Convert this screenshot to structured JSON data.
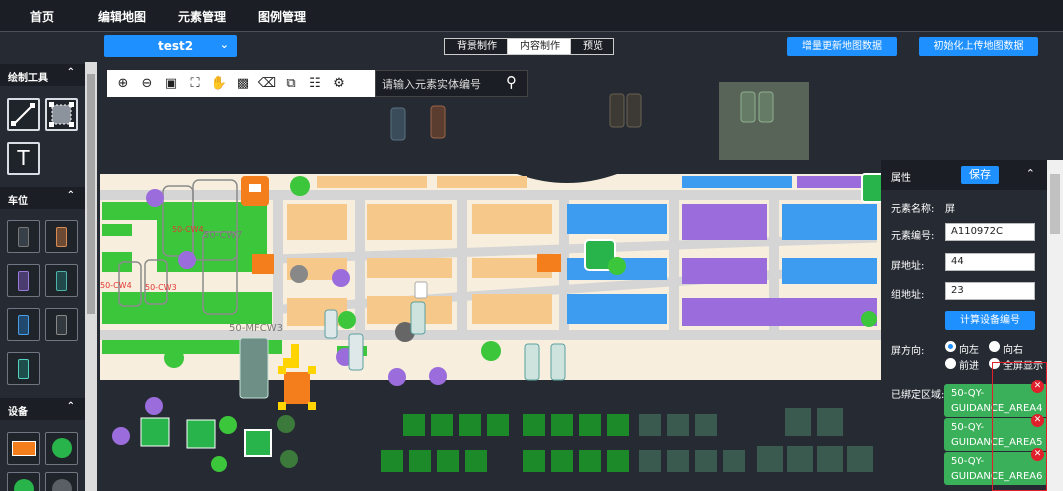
{
  "topnav": {
    "items": [
      "首页",
      "编辑地图",
      "元素管理",
      "图例管理"
    ]
  },
  "project": {
    "selected": "test2"
  },
  "mode_tabs": [
    "背景制作",
    "内容制作",
    "预览"
  ],
  "mode_tabs_active": "内容制作",
  "actions": {
    "increment_update": "增量更新地图数据",
    "init_upload": "初始化上传地图数据"
  },
  "sidebar": {
    "sections": [
      {
        "title": "绘制工具",
        "tools": [
          "line-tool",
          "rectangle-select-tool",
          "text-tool"
        ],
        "text_tool_glyph": "T"
      },
      {
        "title": "车位"
      },
      {
        "title": "设备"
      }
    ]
  },
  "map_tools": {
    "icons": [
      "zoom-in-icon",
      "zoom-out-icon",
      "fit-icon",
      "fullscreen-icon",
      "pan-hand-icon",
      "lock-icon",
      "delete-icon",
      "copy-icon",
      "paste-icon",
      "settings-icon"
    ],
    "search_placeholder": "请输入元素实体编号"
  },
  "map_labels": [
    "50-CW7",
    "50-MFCW3",
    "50-CW4",
    "50-CW3"
  ],
  "panel": {
    "title": "属性",
    "save": "保存",
    "element_name_label": "元素名称:",
    "element_name_value": "屏",
    "element_id_label": "元素编号:",
    "element_id_value": "A110972C",
    "screen_addr_label": "屏地址:",
    "screen_addr_value": "44",
    "group_addr_label": "组地址:",
    "group_addr_value": "23",
    "calc_button": "计算设备编号",
    "direction_label": "屏方向:",
    "direction_options": [
      "向左",
      "向右",
      "前进",
      "全屏显示"
    ],
    "direction_selected": "向左",
    "bound_area_label": "已绑定区域:",
    "bound_areas": [
      "50-QY-GUIDANCE_AREA4",
      "50-QY-GUIDANCE_AREA5",
      "50-QY-GUIDANCE_AREA6"
    ]
  },
  "colors": {
    "accent": "#1e90ff",
    "map_floor": "#f7eedd",
    "road": "#d5d5d5",
    "green_spot": "#3cc63c",
    "blue_spot": "#3d9cf0",
    "purple_spot": "#9b6cdb",
    "orange_spot": "#f6c98b",
    "remove": "#e0202b"
  }
}
